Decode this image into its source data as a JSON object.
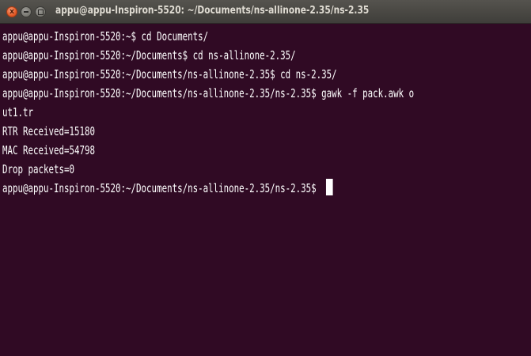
{
  "window": {
    "title": "appu@appu-Inspiron-5520: ~/Documents/ns-allinone-2.35/ns-2.35",
    "close_glyph": "x"
  },
  "terminal": {
    "lines": [
      "appu@appu-Inspiron-5520:~$ cd Documents/",
      "appu@appu-Inspiron-5520:~/Documents$ cd ns-allinone-2.35/",
      "appu@appu-Inspiron-5520:~/Documents/ns-allinone-2.35$ cd ns-2.35/",
      "appu@appu-Inspiron-5520:~/Documents/ns-allinone-2.35/ns-2.35$ gawk -f pack.awk o",
      "ut1.tr",
      "RTR Received=15180",
      "MAC Received=54798",
      "Drop packets=0"
    ],
    "prompt": "appu@appu-Inspiron-5520:~/Documents/ns-allinone-2.35/ns-2.35$ "
  },
  "colors": {
    "terminal_background": "#300a24",
    "terminal_text": "#ffffff",
    "titlebar": "#3f3e3a",
    "close_button": "#e35a26"
  },
  "icons": {
    "close": "close-icon",
    "minimize": "minimize-icon",
    "maximize": "maximize-icon"
  }
}
